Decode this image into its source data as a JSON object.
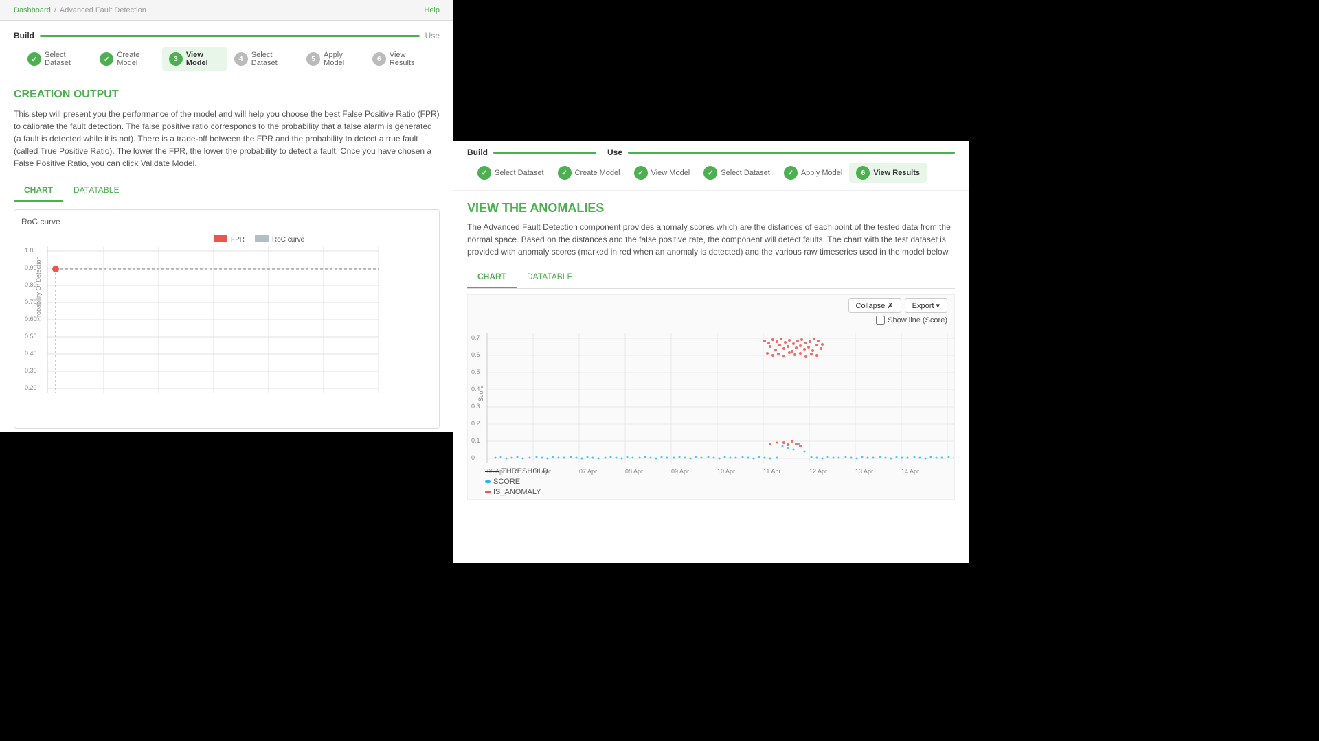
{
  "breadcrumb": {
    "home": "Dashboard",
    "separator": "/",
    "current": "Advanced Fault Detection",
    "help": "Help"
  },
  "left_panel": {
    "build_label": "Build",
    "use_label": "Use",
    "steps": [
      {
        "number": "✓",
        "label": "Select Dataset",
        "state": "done"
      },
      {
        "number": "✓",
        "label": "Create Model",
        "state": "done"
      },
      {
        "number": "3",
        "label": "View Model",
        "state": "active"
      },
      {
        "number": "4",
        "label": "Select Dataset",
        "state": "pending"
      },
      {
        "number": "5",
        "label": "Apply Model",
        "state": "pending"
      },
      {
        "number": "6",
        "label": "View Results",
        "state": "pending"
      }
    ],
    "section_title": "CREATION OUTPUT",
    "description": "This step will present you the performance of the model and will help you choose the best False Positive Ratio (FPR) to calibrate the fault detection. The false positive ratio corresponds to the probability that a false alarm is generated (a fault is detected while it is not). There is a trade-off between the FPR and the probability to detect a true fault (called True Positive Ratio). The lower the FPR, the lower the probability to detect a fault. Once you have chosen a False Positive Ratio, you can click Validate Model.",
    "tab_chart": "CHART",
    "tab_datatable": "DATATABLE",
    "roc_curve_title": "RoC curve",
    "legend_fpr": "FPR",
    "legend_roc": "RoC curve",
    "y_axis_label": "Probability Of Detection",
    "y_values": [
      "1.0",
      "0.90",
      "0.80",
      "0.70",
      "0.60",
      "0.50",
      "0.40",
      "0.30",
      "0.20"
    ],
    "roc_point_y": 0.88
  },
  "right_panel": {
    "build_label": "Build",
    "use_label": "Use",
    "steps": [
      {
        "number": "✓",
        "label": "Select Dataset",
        "state": "done"
      },
      {
        "number": "✓",
        "label": "Create Model",
        "state": "done"
      },
      {
        "number": "✓",
        "label": "View Model",
        "state": "done"
      },
      {
        "number": "✓",
        "label": "Select Dataset",
        "state": "done"
      },
      {
        "number": "✓",
        "label": "Apply Model",
        "state": "done"
      },
      {
        "number": "6",
        "label": "View Results",
        "state": "active"
      }
    ],
    "section_title": "VIEW THE ANOMALIES",
    "description": "The Advanced Fault Detection component provides anomaly scores which are the distances of each point of the tested data from the normal space. Based on the distances and the false positive rate, the component will detect faults. The chart with the test dataset is provided with anomaly scores (marked in red when an anomaly is detected) and the various raw timeseries used in the model below.",
    "tab_chart": "CHART",
    "tab_datatable": "DATATABLE",
    "collapse_btn": "Collapse ✗",
    "export_btn": "Export ▾",
    "show_line_label": "Show line (Score)",
    "x_labels": [
      "05 Apr",
      "06 Apr",
      "07 Apr",
      "08 Apr",
      "09 Apr",
      "10 Apr",
      "11 Apr",
      "12 Apr",
      "13 Apr",
      "14 Apr"
    ],
    "y_values": [
      "0.7",
      "0.6",
      "0.5",
      "0.4",
      "0.3",
      "0.2",
      "0.1",
      "0"
    ],
    "y_label": "Score",
    "legend_threshold": "THRESHOLD",
    "legend_score": "SCORE",
    "legend_anomaly": "IS_ANOMALY"
  }
}
